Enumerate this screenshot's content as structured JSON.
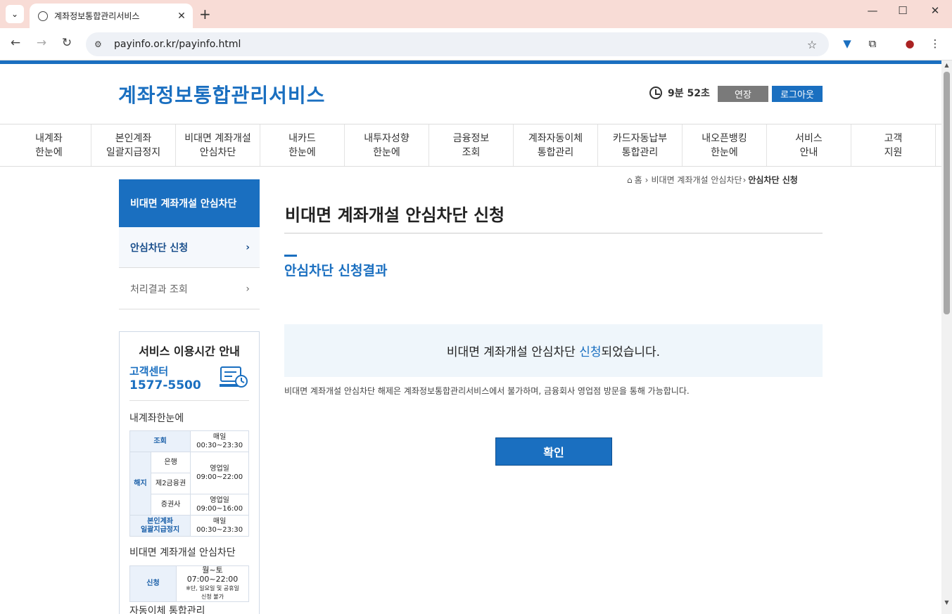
{
  "browser": {
    "tab_title": "계좌정보통합관리서비스",
    "url": "payinfo.or.kr/payinfo.html"
  },
  "header": {
    "logo": "계좌정보통합관리서비스",
    "timer": "9분 52초",
    "extend_label": "연장",
    "logout_label": "로그아웃"
  },
  "gnb": [
    {
      "l1": "내계좌",
      "l2": "한눈에"
    },
    {
      "l1": "본인계좌",
      "l2": "일괄지급정지"
    },
    {
      "l1": "비대면 계좌개설",
      "l2": "안심차단"
    },
    {
      "l1": "내카드",
      "l2": "한눈에"
    },
    {
      "l1": "내투자성향",
      "l2": "한눈에"
    },
    {
      "l1": "금융정보",
      "l2": "조회"
    },
    {
      "l1": "계좌자동이체",
      "l2": "통합관리"
    },
    {
      "l1": "카드자동납부",
      "l2": "통합관리"
    },
    {
      "l1": "내오픈뱅킹",
      "l2": "한눈에"
    },
    {
      "l1": "서비스",
      "l2": "안내"
    },
    {
      "l1": "고객",
      "l2": "지원"
    }
  ],
  "sidebar": {
    "title": "비대면 계좌개설 안심차단",
    "items": [
      {
        "label": "안심차단 신청"
      },
      {
        "label": "처리결과 조회"
      }
    ],
    "info": {
      "title": "서비스 이용시간 안내",
      "cc_label": "고객센터",
      "cc_number": "1577-5500",
      "sec1": "내계좌한눈에",
      "t1": {
        "r1a": "조회",
        "r1b": "매일",
        "r1c": "00:30~23:30",
        "r2a": "해지",
        "r2b": "은행",
        "r2c": "영업일",
        "r2d": "09:00~22:00",
        "r3b": "제2금융권",
        "r4b": "증권사",
        "r4c": "영업일",
        "r4d": "09:00~16:00",
        "r5a1": "본인계좌",
        "r5a2": "일괄지급정지",
        "r5b": "매일",
        "r5c": "00:30~23:30"
      },
      "sec2": "비대면 계좌개설 안심차단",
      "t2": {
        "a": "신청",
        "b": "월~토 07:00~22:00",
        "c": "※단, 일요일 및 공휴일",
        "d": "신청 불가"
      },
      "sec3": "자동이체 통합관리"
    }
  },
  "breadcrumb": {
    "home": "홈",
    "mid": "비대면 계좌개설 안심차단",
    "current": "안심차단 신청"
  },
  "main": {
    "page_title": "비대면 계좌개설 안심차단 신청",
    "sub_title": "안심차단 신청결과",
    "result_pre": "비대면 계좌개설 안심차단 ",
    "result_hl": "신청",
    "result_post": "되었습니다.",
    "notice": "비대면 계좌개설 안심차단 해제은 계좌정보통합관리서비스에서 불가하며, 금융회사 영업점 방문을 통해 가능합니다.",
    "confirm_label": "확인"
  },
  "colors": {
    "brand": "#1a6fc0",
    "tabstrip": "#f8dcd6"
  }
}
